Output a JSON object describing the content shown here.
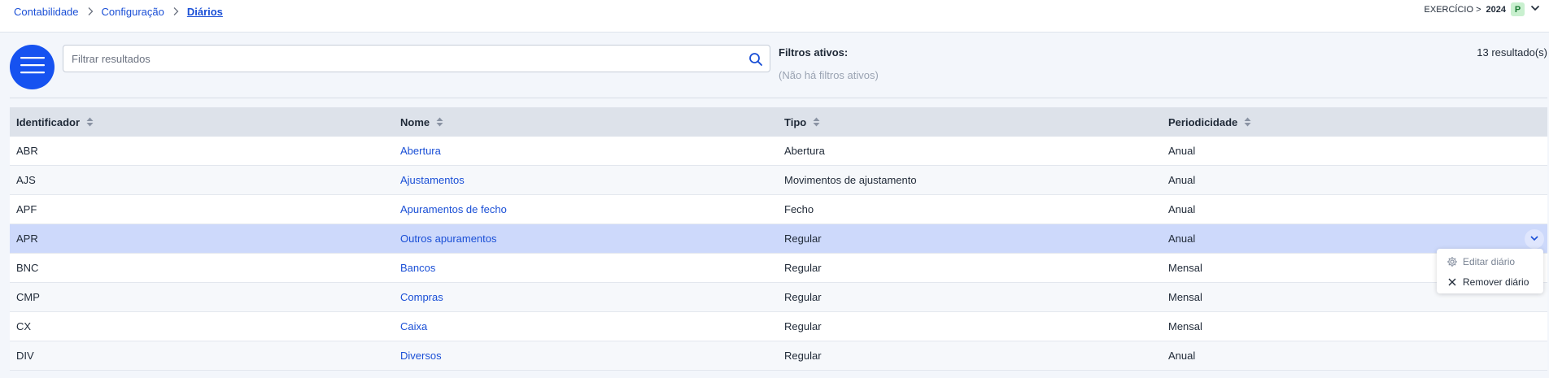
{
  "breadcrumb": {
    "items": [
      "Contabilidade",
      "Configuração",
      "Diários"
    ]
  },
  "exercise": {
    "label": "EXERCÍCIO >",
    "year": "2024",
    "badge": "P"
  },
  "search": {
    "placeholder": "Filtrar resultados",
    "value": ""
  },
  "filters": {
    "title": "Filtros ativos:",
    "empty": "(Não há filtros ativos)"
  },
  "results": "13 resultado(s)",
  "table": {
    "columns": [
      "Identificador",
      "Nome",
      "Tipo",
      "Periodicidade"
    ],
    "rows": [
      {
        "id": "ABR",
        "name": "Abertura",
        "type": "Abertura",
        "period": "Anual"
      },
      {
        "id": "AJS",
        "name": "Ajustamentos",
        "type": "Movimentos de ajustamento",
        "period": "Anual"
      },
      {
        "id": "APF",
        "name": "Apuramentos de fecho",
        "type": "Fecho",
        "period": "Anual"
      },
      {
        "id": "APR",
        "name": "Outros apuramentos",
        "type": "Regular",
        "period": "Anual"
      },
      {
        "id": "BNC",
        "name": "Bancos",
        "type": "Regular",
        "period": "Mensal"
      },
      {
        "id": "CMP",
        "name": "Compras",
        "type": "Regular",
        "period": "Mensal"
      },
      {
        "id": "CX",
        "name": "Caixa",
        "type": "Regular",
        "period": "Mensal"
      },
      {
        "id": "DIV",
        "name": "Diversos",
        "type": "Regular",
        "period": "Anual"
      }
    ]
  },
  "context_menu": {
    "items": [
      "Editar diário",
      "Remover diário"
    ]
  },
  "colors": {
    "accent": "#1652f0",
    "link": "#1a4fd6",
    "selected_row": "#cdd9fb",
    "header_bg": "#dde2ea"
  },
  "icons": [
    "chevron-right-icon",
    "chevron-down-icon",
    "hamburger-menu-icon",
    "search-icon",
    "sort-icon",
    "gear-icon",
    "close-icon"
  ]
}
